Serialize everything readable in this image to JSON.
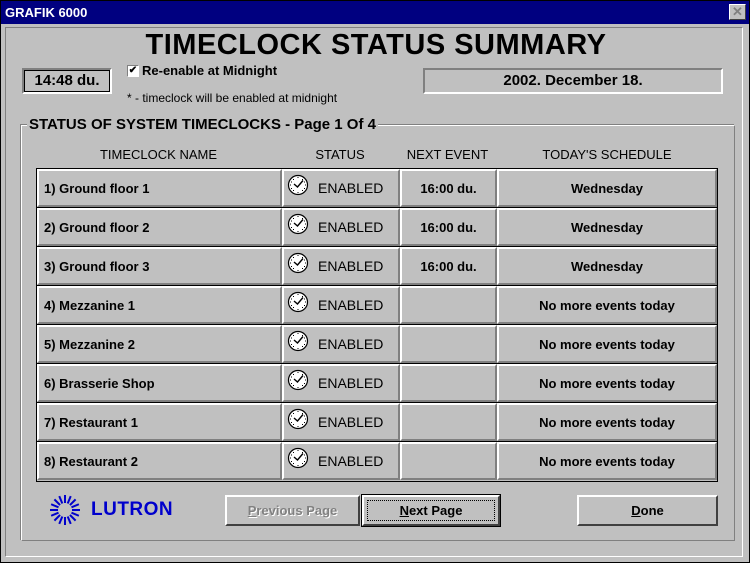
{
  "window": {
    "title": "GRAFIK 6000",
    "close_label": "✕"
  },
  "header": {
    "title": "TIMECLOCK STATUS SUMMARY",
    "time": "14:48 du.",
    "date": "2002. December 18.",
    "reenable": {
      "label": "Re-enable at Midnight",
      "checked": true,
      "check_glyph": "✔"
    },
    "note": "* - timeclock will be enabled at midnight"
  },
  "group": {
    "title": "STATUS OF SYSTEM TIMECLOCKS - Page 1 Of 4",
    "page": 1,
    "page_count": 4
  },
  "table": {
    "columns": [
      "TIMECLOCK NAME",
      "STATUS",
      "NEXT EVENT",
      "TODAY'S SCHEDULE"
    ],
    "rows": [
      {
        "name": "1) Ground floor 1",
        "status": "ENABLED",
        "status_icon": "clock-icon",
        "next_event": "16:00 du.",
        "schedule": "Wednesday"
      },
      {
        "name": "2) Ground floor 2",
        "status": "ENABLED",
        "status_icon": "clock-icon",
        "next_event": "16:00 du.",
        "schedule": "Wednesday"
      },
      {
        "name": "3) Ground floor 3",
        "status": "ENABLED",
        "status_icon": "clock-icon",
        "next_event": "16:00 du.",
        "schedule": "Wednesday"
      },
      {
        "name": "4) Mezzanine 1",
        "status": "ENABLED",
        "status_icon": "clock-icon",
        "next_event": "",
        "schedule": "No more events today"
      },
      {
        "name": "5) Mezzanine 2",
        "status": "ENABLED",
        "status_icon": "clock-icon",
        "next_event": "",
        "schedule": "No more events today"
      },
      {
        "name": "6) Brasserie Shop",
        "status": "ENABLED",
        "status_icon": "clock-icon",
        "next_event": "",
        "schedule": "No more events today"
      },
      {
        "name": "7) Restaurant 1",
        "status": "ENABLED",
        "status_icon": "clock-icon",
        "next_event": "",
        "schedule": "No more events today"
      },
      {
        "name": "8) Restaurant 2",
        "status": "ENABLED",
        "status_icon": "clock-icon",
        "next_event": "",
        "schedule": "No more events today"
      }
    ]
  },
  "footer": {
    "logo_text": "LUTRON",
    "logo_color": "#0000cc",
    "prev_button": {
      "mnemonic": "P",
      "rest": "revious Page",
      "enabled": false
    },
    "next_button": {
      "mnemonic": "N",
      "rest": "ext Page",
      "enabled": true
    },
    "done_button": {
      "mnemonic": "D",
      "rest": "one",
      "enabled": true
    }
  },
  "colors": {
    "titlebar": "#000080",
    "face": "#c0c0c0",
    "disabled_text": "#808080"
  }
}
